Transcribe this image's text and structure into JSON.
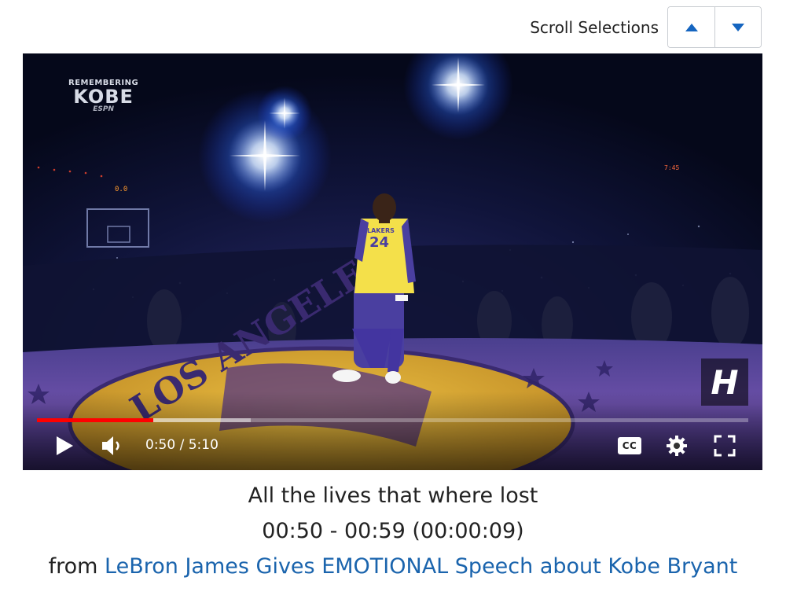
{
  "scroll": {
    "label": "Scroll Selections",
    "up_icon": "caret-up-icon",
    "down_icon": "caret-down-icon",
    "accent": "#1565c0"
  },
  "video": {
    "watermark": {
      "line1": "REMEMBERING",
      "line2": "KOBE",
      "line3": "ESPN"
    },
    "player_number": "24",
    "jersey_text": "LAKERS",
    "court_text": "LOS ANGELES",
    "scoreboard_left": "0.0",
    "scoreboard_right": "7:45",
    "channel_logo": "H",
    "progress": {
      "played_fraction": 0.163,
      "loaded_fraction": 0.3,
      "played_color": "#ff0000"
    },
    "time_display": "0:50 / 5:10",
    "controls": {
      "play_icon": "play-icon",
      "volume_icon": "volume-icon",
      "captions_label": "CC",
      "settings_icon": "gear-icon",
      "fullscreen_icon": "fullscreen-icon"
    }
  },
  "caption": {
    "title": "All the lives that where lost",
    "range": "00:50 - 00:59 (00:00:09)",
    "from_prefix": "from",
    "source_link": "LeBron James Gives EMOTIONAL Speech about Kobe Bryant",
    "link_color": "#1a64ad"
  }
}
